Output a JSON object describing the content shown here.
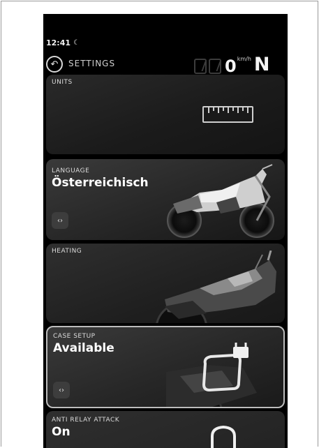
{
  "status_bar": {
    "time": "12:41",
    "mode_icon": "moon-icon"
  },
  "header": {
    "back_icon": "back-arrow-icon",
    "title": "SETTINGS",
    "speed": "0",
    "speed_unit": "km/h",
    "gear": "N"
  },
  "cards": {
    "units": {
      "label": "UNITS",
      "icon": "ruler-icon"
    },
    "language": {
      "label": "LANGUAGE",
      "value": "Österreichisch",
      "control": "‹›",
      "image": "motorcycle-silhouette"
    },
    "heating": {
      "label": "HEATING",
      "image": "motorcycle-closeup"
    },
    "case_setup": {
      "label": "CASE SETUP",
      "value": "Available",
      "control": "‹›",
      "icon": "lock-icon",
      "selected": true
    },
    "anti_relay_attack": {
      "label": "ANTI RELAY ATTACK",
      "value": "On",
      "icon": "shield-icon"
    }
  },
  "colors": {
    "background": "#000000",
    "card": "#222222",
    "text": "#ffffff",
    "selected_border": "#bdbdbd"
  }
}
